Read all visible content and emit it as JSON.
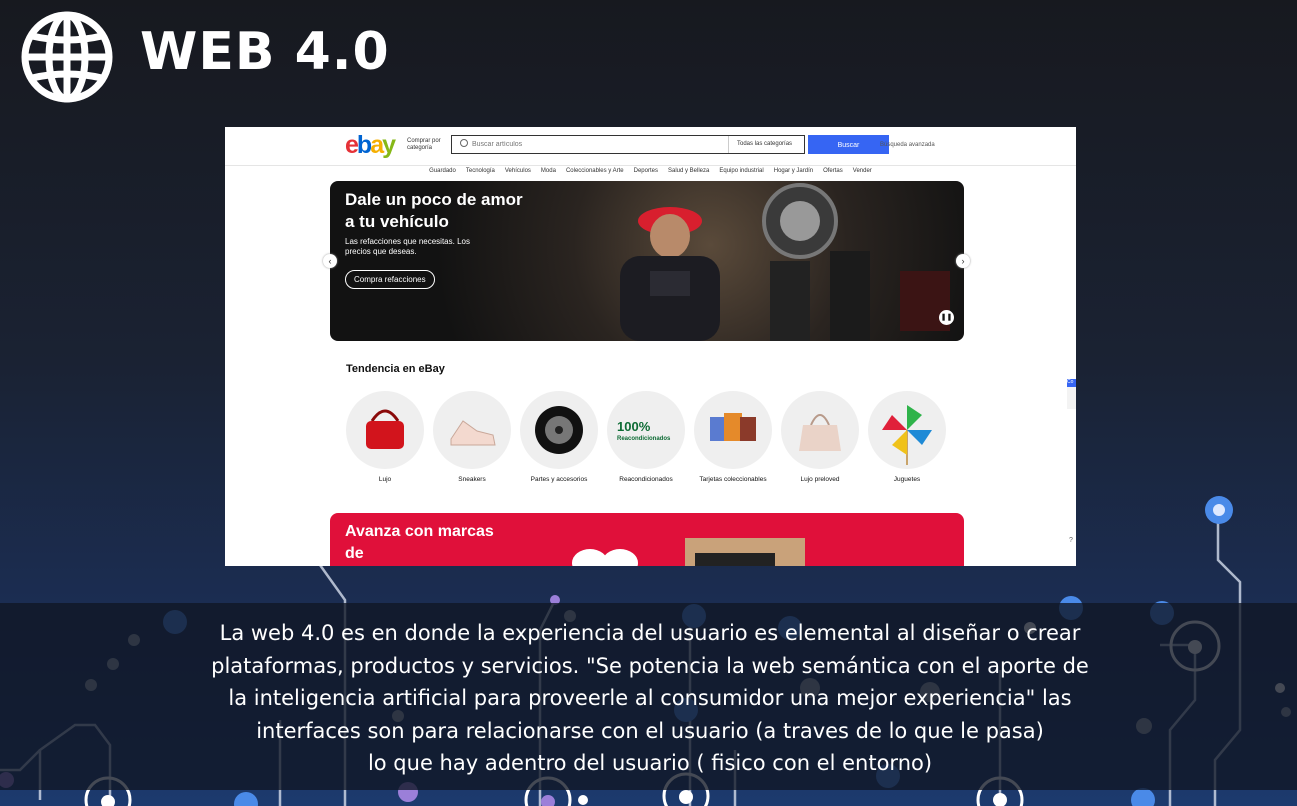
{
  "slide": {
    "title": "WEB 4.0",
    "caption_lines": [
      "La web 4.0 es en donde la experiencia del usuario es elemental al diseñar o crear",
      "plataformas, productos y servicios. \"Se potencia la web semántica con el aporte de",
      "la inteligencia artificial para proveerle al consumidor una mejor experiencia\"  las",
      "interfaces son para relacionarse con el usuario (a traves de lo que le pasa)",
      "lo que hay adentro del usuario (  fisico con el entorno)"
    ],
    "icons": {
      "globe": "globe-icon"
    }
  },
  "ebay": {
    "logo": {
      "e": "e",
      "b": "b",
      "a": "a",
      "y": "y"
    },
    "shop_by_category": "Comprar por categoría",
    "search": {
      "placeholder": "Buscar artículos",
      "category_select": "Todas las categorías",
      "button": "Buscar",
      "advanced": "Búsqueda avanzada"
    },
    "nav": [
      "Guardado",
      "Tecnología",
      "Vehículos",
      "Moda",
      "Coleccionables y Arte",
      "Deportes",
      "Salud y Belleza",
      "Equipo industrial",
      "Hogar y Jardín",
      "Ofertas",
      "Vender"
    ],
    "hero": {
      "title": "Dale un poco de amor a tu vehículo",
      "subtitle": "Las refacciones que necesitas. Los precios que deseas.",
      "cta": "Compra refacciones"
    },
    "trending_title": "Tendencia en eBay",
    "categories": [
      {
        "label": "Lujo",
        "icon": "handbag-icon"
      },
      {
        "label": "Sneakers",
        "icon": "sneaker-icon"
      },
      {
        "label": "Partes y accesorios",
        "icon": "wheel-icon"
      },
      {
        "label": "Reacondicionados",
        "icon": "refurbished-badge-icon"
      },
      {
        "label": "Tarjetas coleccionables",
        "icon": "cards-icon"
      },
      {
        "label": "Lujo preloved",
        "icon": "bag-icon"
      },
      {
        "label": "Juguetes",
        "icon": "pinwheel-icon"
      }
    ],
    "refurb_badge": {
      "percent": "100%",
      "text": "Reacondicionados"
    },
    "promo": {
      "title": "Avanza con marcas de"
    },
    "side_tab": "Co",
    "help": "?"
  },
  "colors": {
    "accent": "#3665f3",
    "promo": "#e0103a"
  }
}
